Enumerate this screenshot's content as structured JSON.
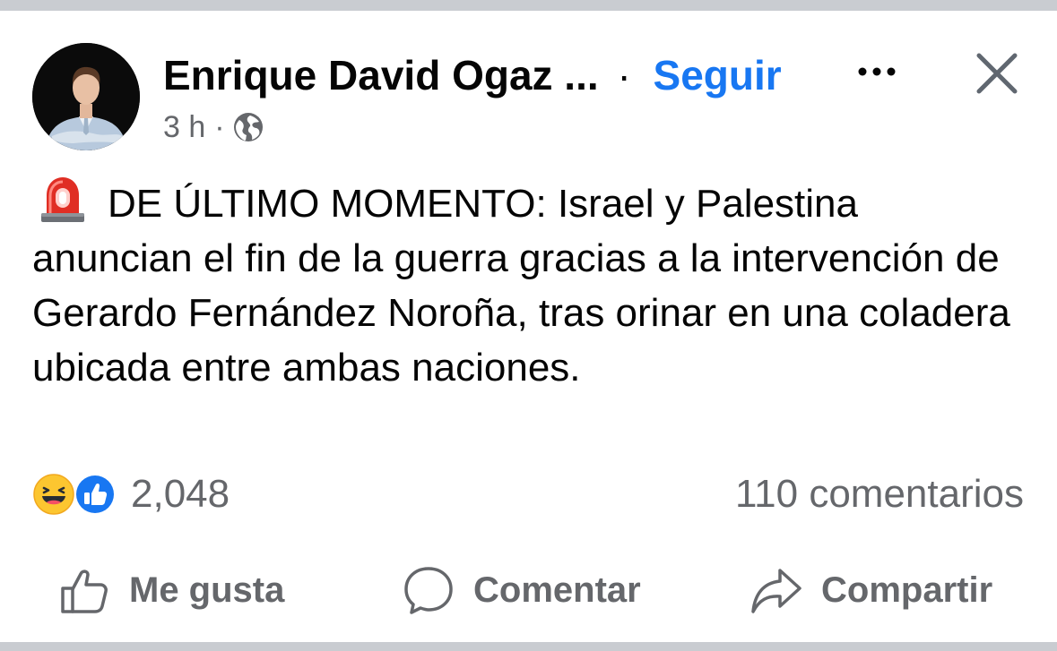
{
  "post": {
    "author": "Enrique David Ogaz ...",
    "separator": "·",
    "follow_label": "Seguir",
    "time": "3 h",
    "meta_separator": "·",
    "audience_icon": "globe-icon",
    "body_text": "DE ÚLTIMO MOMENTO: Israel y Palestina anuncian el fin de la guerra gracias a la intervención de Gerardo Fernández Noroña, tras orinar en una coladera ubicada entre ambas naciones.",
    "body_emoji": "police-siren-icon"
  },
  "reactions": {
    "icons": [
      "haha-icon",
      "like-icon"
    ],
    "count": "2,048",
    "comments": "110 comentarios"
  },
  "actions": {
    "like": "Me gusta",
    "comment": "Comentar",
    "share": "Compartir"
  },
  "colors": {
    "accent": "#1877f2",
    "secondary_text": "#65676b",
    "divider": "#c9ccd1"
  }
}
